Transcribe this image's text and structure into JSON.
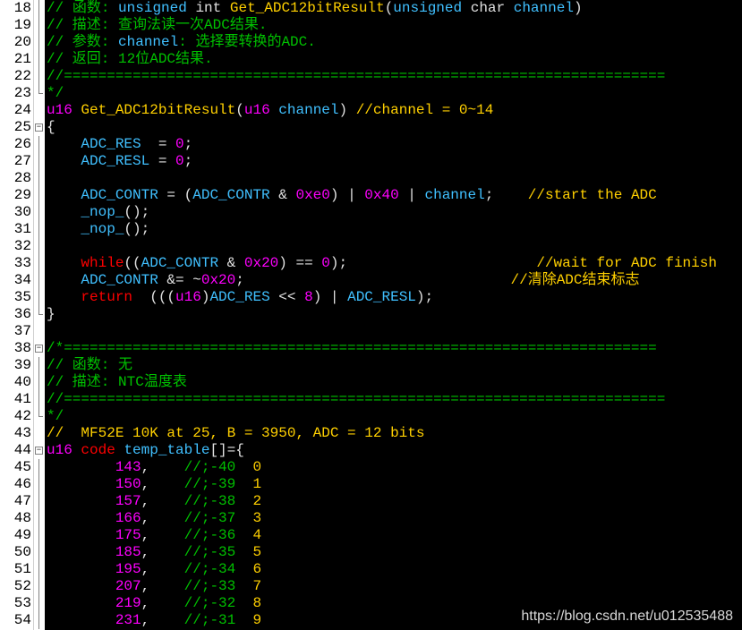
{
  "editor": {
    "watermark": "https://blog.csdn.net/u012535488",
    "lines": [
      {
        "n": "18",
        "fold": "line",
        "segs": [
          [
            "c-com",
            "// "
          ],
          [
            "c-com",
            "函数: "
          ],
          [
            "c-id",
            "unsigned"
          ],
          [
            "c-w",
            " int "
          ],
          [
            "c-y",
            "Get_ADC12bitResult"
          ],
          [
            "c-w",
            "("
          ],
          [
            "c-id",
            "unsigned"
          ],
          [
            "c-w",
            " char "
          ],
          [
            "c-id",
            "channel"
          ],
          [
            "c-w",
            ")"
          ]
        ]
      },
      {
        "n": "19",
        "fold": "line",
        "segs": [
          [
            "c-com",
            "// 描述: 查询法读一次ADC结果."
          ]
        ]
      },
      {
        "n": "20",
        "fold": "line",
        "segs": [
          [
            "c-com",
            "// 参数: "
          ],
          [
            "c-id",
            "channel"
          ],
          [
            "c-com",
            ": 选择要转换的ADC."
          ]
        ]
      },
      {
        "n": "21",
        "fold": "line",
        "segs": [
          [
            "c-com",
            "// 返回: 12位ADC结果."
          ]
        ]
      },
      {
        "n": "22",
        "fold": "line",
        "segs": [
          [
            "c-com",
            "//======================================================================"
          ]
        ]
      },
      {
        "n": "23",
        "fold": "end",
        "segs": [
          [
            "c-com",
            "*/"
          ]
        ]
      },
      {
        "n": "24",
        "fold": "",
        "segs": [
          [
            "c-ty",
            "u16"
          ],
          [
            "c-w",
            " "
          ],
          [
            "c-y",
            "Get_ADC12bitResult"
          ],
          [
            "c-w",
            "("
          ],
          [
            "c-ty",
            "u16"
          ],
          [
            "c-w",
            " "
          ],
          [
            "c-id",
            "channel"
          ],
          [
            "c-w",
            ") "
          ],
          [
            "c-y",
            "//channel = 0~14"
          ]
        ]
      },
      {
        "n": "25",
        "fold": "box",
        "segs": [
          [
            "c-w",
            "{"
          ]
        ]
      },
      {
        "n": "26",
        "fold": "line",
        "segs": [
          [
            "c-w",
            "    "
          ],
          [
            "c-id",
            "ADC_RES"
          ],
          [
            "c-w",
            "  = "
          ],
          [
            "c-n",
            "0"
          ],
          [
            "c-w",
            ";"
          ]
        ]
      },
      {
        "n": "27",
        "fold": "line",
        "segs": [
          [
            "c-w",
            "    "
          ],
          [
            "c-id",
            "ADC_RESL"
          ],
          [
            "c-w",
            " = "
          ],
          [
            "c-n",
            "0"
          ],
          [
            "c-w",
            ";"
          ]
        ]
      },
      {
        "n": "28",
        "fold": "line",
        "segs": []
      },
      {
        "n": "29",
        "fold": "line",
        "segs": [
          [
            "c-w",
            "    "
          ],
          [
            "c-id",
            "ADC_CONTR"
          ],
          [
            "c-w",
            " = ("
          ],
          [
            "c-id",
            "ADC_CONTR"
          ],
          [
            "c-w",
            " & "
          ],
          [
            "c-n",
            "0xe0"
          ],
          [
            "c-w",
            ") | "
          ],
          [
            "c-n",
            "0x40"
          ],
          [
            "c-w",
            " | "
          ],
          [
            "c-id",
            "channel"
          ],
          [
            "c-w",
            ";    "
          ],
          [
            "c-y",
            "//start the ADC"
          ]
        ]
      },
      {
        "n": "30",
        "fold": "line",
        "segs": [
          [
            "c-w",
            "    "
          ],
          [
            "c-id",
            "_nop_"
          ],
          [
            "c-w",
            "();"
          ]
        ]
      },
      {
        "n": "31",
        "fold": "line",
        "segs": [
          [
            "c-w",
            "    "
          ],
          [
            "c-id",
            "_nop_"
          ],
          [
            "c-w",
            "();"
          ]
        ]
      },
      {
        "n": "32",
        "fold": "line",
        "segs": []
      },
      {
        "n": "33",
        "fold": "line",
        "segs": [
          [
            "c-w",
            "    "
          ],
          [
            "c-kw",
            "while"
          ],
          [
            "c-w",
            "(("
          ],
          [
            "c-id",
            "ADC_CONTR"
          ],
          [
            "c-w",
            " & "
          ],
          [
            "c-n",
            "0x20"
          ],
          [
            "c-w",
            ") == "
          ],
          [
            "c-n",
            "0"
          ],
          [
            "c-w",
            ");                      "
          ],
          [
            "c-y",
            "//wait for ADC finish"
          ]
        ]
      },
      {
        "n": "34",
        "fold": "line",
        "segs": [
          [
            "c-w",
            "    "
          ],
          [
            "c-id",
            "ADC_CONTR"
          ],
          [
            "c-w",
            " &= ~"
          ],
          [
            "c-n",
            "0x20"
          ],
          [
            "c-w",
            ";                               "
          ],
          [
            "c-y",
            "//清除ADC结束标志"
          ]
        ]
      },
      {
        "n": "35",
        "fold": "line",
        "segs": [
          [
            "c-w",
            "    "
          ],
          [
            "c-kw",
            "return"
          ],
          [
            "c-w",
            "  ((("
          ],
          [
            "c-ty",
            "u16"
          ],
          [
            "c-w",
            ")"
          ],
          [
            "c-id",
            "ADC_RES"
          ],
          [
            "c-w",
            " << "
          ],
          [
            "c-n",
            "8"
          ],
          [
            "c-w",
            ") | "
          ],
          [
            "c-id",
            "ADC_RESL"
          ],
          [
            "c-w",
            ");"
          ]
        ]
      },
      {
        "n": "36",
        "fold": "end",
        "segs": [
          [
            "c-w",
            "}"
          ]
        ]
      },
      {
        "n": "37",
        "fold": "",
        "segs": []
      },
      {
        "n": "38",
        "fold": "box",
        "segs": [
          [
            "c-com",
            "/*====================================================================="
          ]
        ]
      },
      {
        "n": "39",
        "fold": "line",
        "segs": [
          [
            "c-com",
            "// 函数: 无"
          ]
        ]
      },
      {
        "n": "40",
        "fold": "line",
        "segs": [
          [
            "c-com",
            "// 描述: NTC温度表"
          ]
        ]
      },
      {
        "n": "41",
        "fold": "line",
        "segs": [
          [
            "c-com",
            "//======================================================================"
          ]
        ]
      },
      {
        "n": "42",
        "fold": "end",
        "segs": [
          [
            "c-com",
            "*/"
          ]
        ]
      },
      {
        "n": "43",
        "fold": "",
        "segs": [
          [
            "c-y",
            "//  MF52E 10K at 25, B = 3950, ADC = 12 bits"
          ]
        ]
      },
      {
        "n": "44",
        "fold": "box",
        "segs": [
          [
            "c-ty",
            "u16"
          ],
          [
            "c-w",
            " "
          ],
          [
            "c-kw",
            "code"
          ],
          [
            "c-w",
            " "
          ],
          [
            "c-id",
            "temp_table"
          ],
          [
            "c-w",
            "[]={"
          ]
        ]
      },
      {
        "n": "45",
        "fold": "line",
        "segs": [
          [
            "c-w",
            "        "
          ],
          [
            "c-n",
            "143"
          ],
          [
            "c-w",
            ",    "
          ],
          [
            "c-com",
            "//;-40  "
          ],
          [
            "c-y",
            "0"
          ]
        ]
      },
      {
        "n": "46",
        "fold": "line",
        "segs": [
          [
            "c-w",
            "        "
          ],
          [
            "c-n",
            "150"
          ],
          [
            "c-w",
            ",    "
          ],
          [
            "c-com",
            "//;-39  "
          ],
          [
            "c-y",
            "1"
          ]
        ]
      },
      {
        "n": "47",
        "fold": "line",
        "segs": [
          [
            "c-w",
            "        "
          ],
          [
            "c-n",
            "157"
          ],
          [
            "c-w",
            ",    "
          ],
          [
            "c-com",
            "//;-38  "
          ],
          [
            "c-y",
            "2"
          ]
        ]
      },
      {
        "n": "48",
        "fold": "line",
        "segs": [
          [
            "c-w",
            "        "
          ],
          [
            "c-n",
            "166"
          ],
          [
            "c-w",
            ",    "
          ],
          [
            "c-com",
            "//;-37  "
          ],
          [
            "c-y",
            "3"
          ]
        ]
      },
      {
        "n": "49",
        "fold": "line",
        "segs": [
          [
            "c-w",
            "        "
          ],
          [
            "c-n",
            "175"
          ],
          [
            "c-w",
            ",    "
          ],
          [
            "c-com",
            "//;-36  "
          ],
          [
            "c-y",
            "4"
          ]
        ]
      },
      {
        "n": "50",
        "fold": "line",
        "segs": [
          [
            "c-w",
            "        "
          ],
          [
            "c-n",
            "185"
          ],
          [
            "c-w",
            ",    "
          ],
          [
            "c-com",
            "//;-35  "
          ],
          [
            "c-y",
            "5"
          ]
        ]
      },
      {
        "n": "51",
        "fold": "line",
        "segs": [
          [
            "c-w",
            "        "
          ],
          [
            "c-n",
            "195"
          ],
          [
            "c-w",
            ",    "
          ],
          [
            "c-com",
            "//;-34  "
          ],
          [
            "c-y",
            "6"
          ]
        ]
      },
      {
        "n": "52",
        "fold": "line",
        "segs": [
          [
            "c-w",
            "        "
          ],
          [
            "c-n",
            "207"
          ],
          [
            "c-w",
            ",    "
          ],
          [
            "c-com",
            "//;-33  "
          ],
          [
            "c-y",
            "7"
          ]
        ]
      },
      {
        "n": "53",
        "fold": "line",
        "segs": [
          [
            "c-w",
            "        "
          ],
          [
            "c-n",
            "219"
          ],
          [
            "c-w",
            ",    "
          ],
          [
            "c-com",
            "//;-32  "
          ],
          [
            "c-y",
            "8"
          ]
        ]
      },
      {
        "n": "54",
        "fold": "line",
        "segs": [
          [
            "c-w",
            "        "
          ],
          [
            "c-n",
            "231"
          ],
          [
            "c-w",
            ",    "
          ],
          [
            "c-com",
            "//;-31  "
          ],
          [
            "c-y",
            "9"
          ]
        ]
      }
    ]
  }
}
